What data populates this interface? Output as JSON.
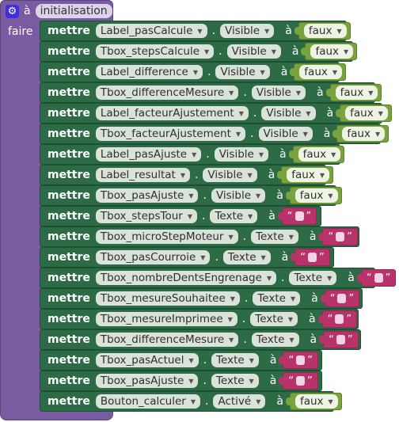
{
  "event": {
    "prefix": "à",
    "name": "initialisation",
    "body_label": "faire"
  },
  "keywords": {
    "set": "mettre",
    "to": "à",
    "dot": "."
  },
  "statements": [
    {
      "component": "Label_pasCalcule",
      "property": "Visible",
      "value_type": "bool",
      "value": "faux",
      "width": 388
    },
    {
      "component": "Tbox_stepsCalcule",
      "property": "Visible",
      "value_type": "bool",
      "value": "faux",
      "width": 396
    },
    {
      "component": "Label_difference",
      "property": "Visible",
      "value_type": "bool",
      "value": "faux",
      "width": 379
    },
    {
      "component": "Tbox_differenceMesure",
      "property": "Visible",
      "value_type": "bool",
      "value": "faux",
      "width": 424
    },
    {
      "component": "Label_facteurAjustement",
      "property": "Visible",
      "value_type": "bool",
      "value": "faux",
      "width": 433
    },
    {
      "component": "Tbox_facteurAjustement",
      "property": "Visible",
      "value_type": "bool",
      "value": "faux",
      "width": 431
    },
    {
      "component": "Label_pasAjuste",
      "property": "Visible",
      "value_type": "bool",
      "value": "faux",
      "width": 380
    },
    {
      "component": "Label_resultat",
      "property": "Visible",
      "value_type": "bool",
      "value": "faux",
      "width": 362
    },
    {
      "component": "Tbox_pasAjuste",
      "property": "Visible",
      "value_type": "bool",
      "value": "faux",
      "width": 375
    },
    {
      "component": "Tbox_stepsTour",
      "property": "Texte",
      "value_type": "text",
      "value": "",
      "width": 356
    },
    {
      "component": "Tbox_microStepMoteur",
      "property": "Texte",
      "value_type": "text",
      "value": "",
      "width": 404
    },
    {
      "component": "Tbox_pasCourroie",
      "property": "Texte",
      "value_type": "text",
      "value": "",
      "width": 372
    },
    {
      "component": "Tbox_nombreDentsEngrenage",
      "property": "Texte",
      "value_type": "text",
      "value": "",
      "width": 424
    },
    {
      "component": "Tbox_mesureSouhaitee",
      "property": "Texte",
      "value_type": "text",
      "value": "",
      "width": 408
    },
    {
      "component": "Tbox_mesureImprimee",
      "property": "Texte",
      "value_type": "text",
      "value": "",
      "width": 403
    },
    {
      "component": "Tbox_differenceMesure",
      "property": "Texte",
      "value_type": "text",
      "value": "",
      "width": 406
    },
    {
      "component": "Tbox_pasActuel",
      "property": "Texte",
      "value_type": "text",
      "value": "",
      "width": 357
    },
    {
      "component": "Tbox_pasAjuste",
      "property": "Texte",
      "value_type": "text",
      "value": "",
      "width": 357
    },
    {
      "component": "Bouton_calculer",
      "property": "Activé",
      "value_type": "bool",
      "value": "faux",
      "width": 372
    }
  ],
  "colors": {
    "event": "#7a5aa0",
    "setter": "#2d6a46",
    "logic": "#79a33e",
    "text": "#b8336a"
  }
}
